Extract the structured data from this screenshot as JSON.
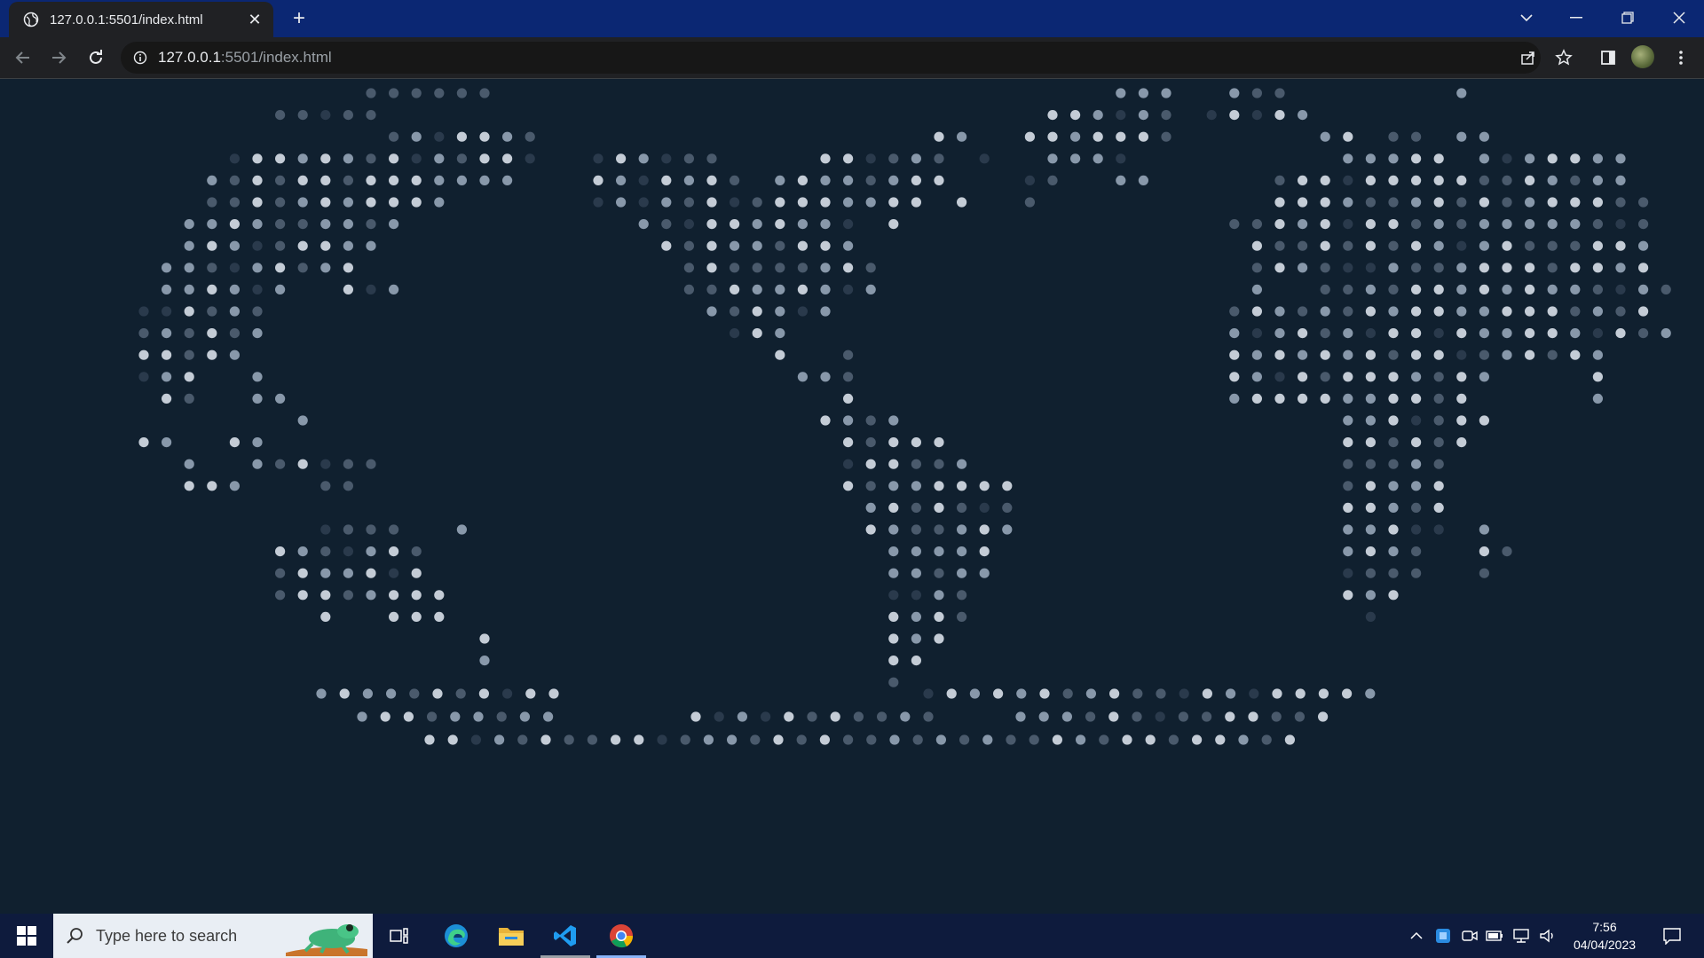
{
  "browser": {
    "tab": {
      "title": "127.0.0.1:5501/index.html"
    },
    "new_tab": "+",
    "address": {
      "host": "127.0.0.1",
      "path": ":5501/index.html"
    }
  },
  "page": {
    "background": "#10202f",
    "dot_colors": [
      "#2a3a4c",
      "#4a5a6c",
      "#8898aa",
      "#c4ccd6"
    ]
  },
  "taskbar": {
    "search_placeholder": "Type here to search",
    "time": "7:56",
    "date": "04/04/2023"
  }
}
